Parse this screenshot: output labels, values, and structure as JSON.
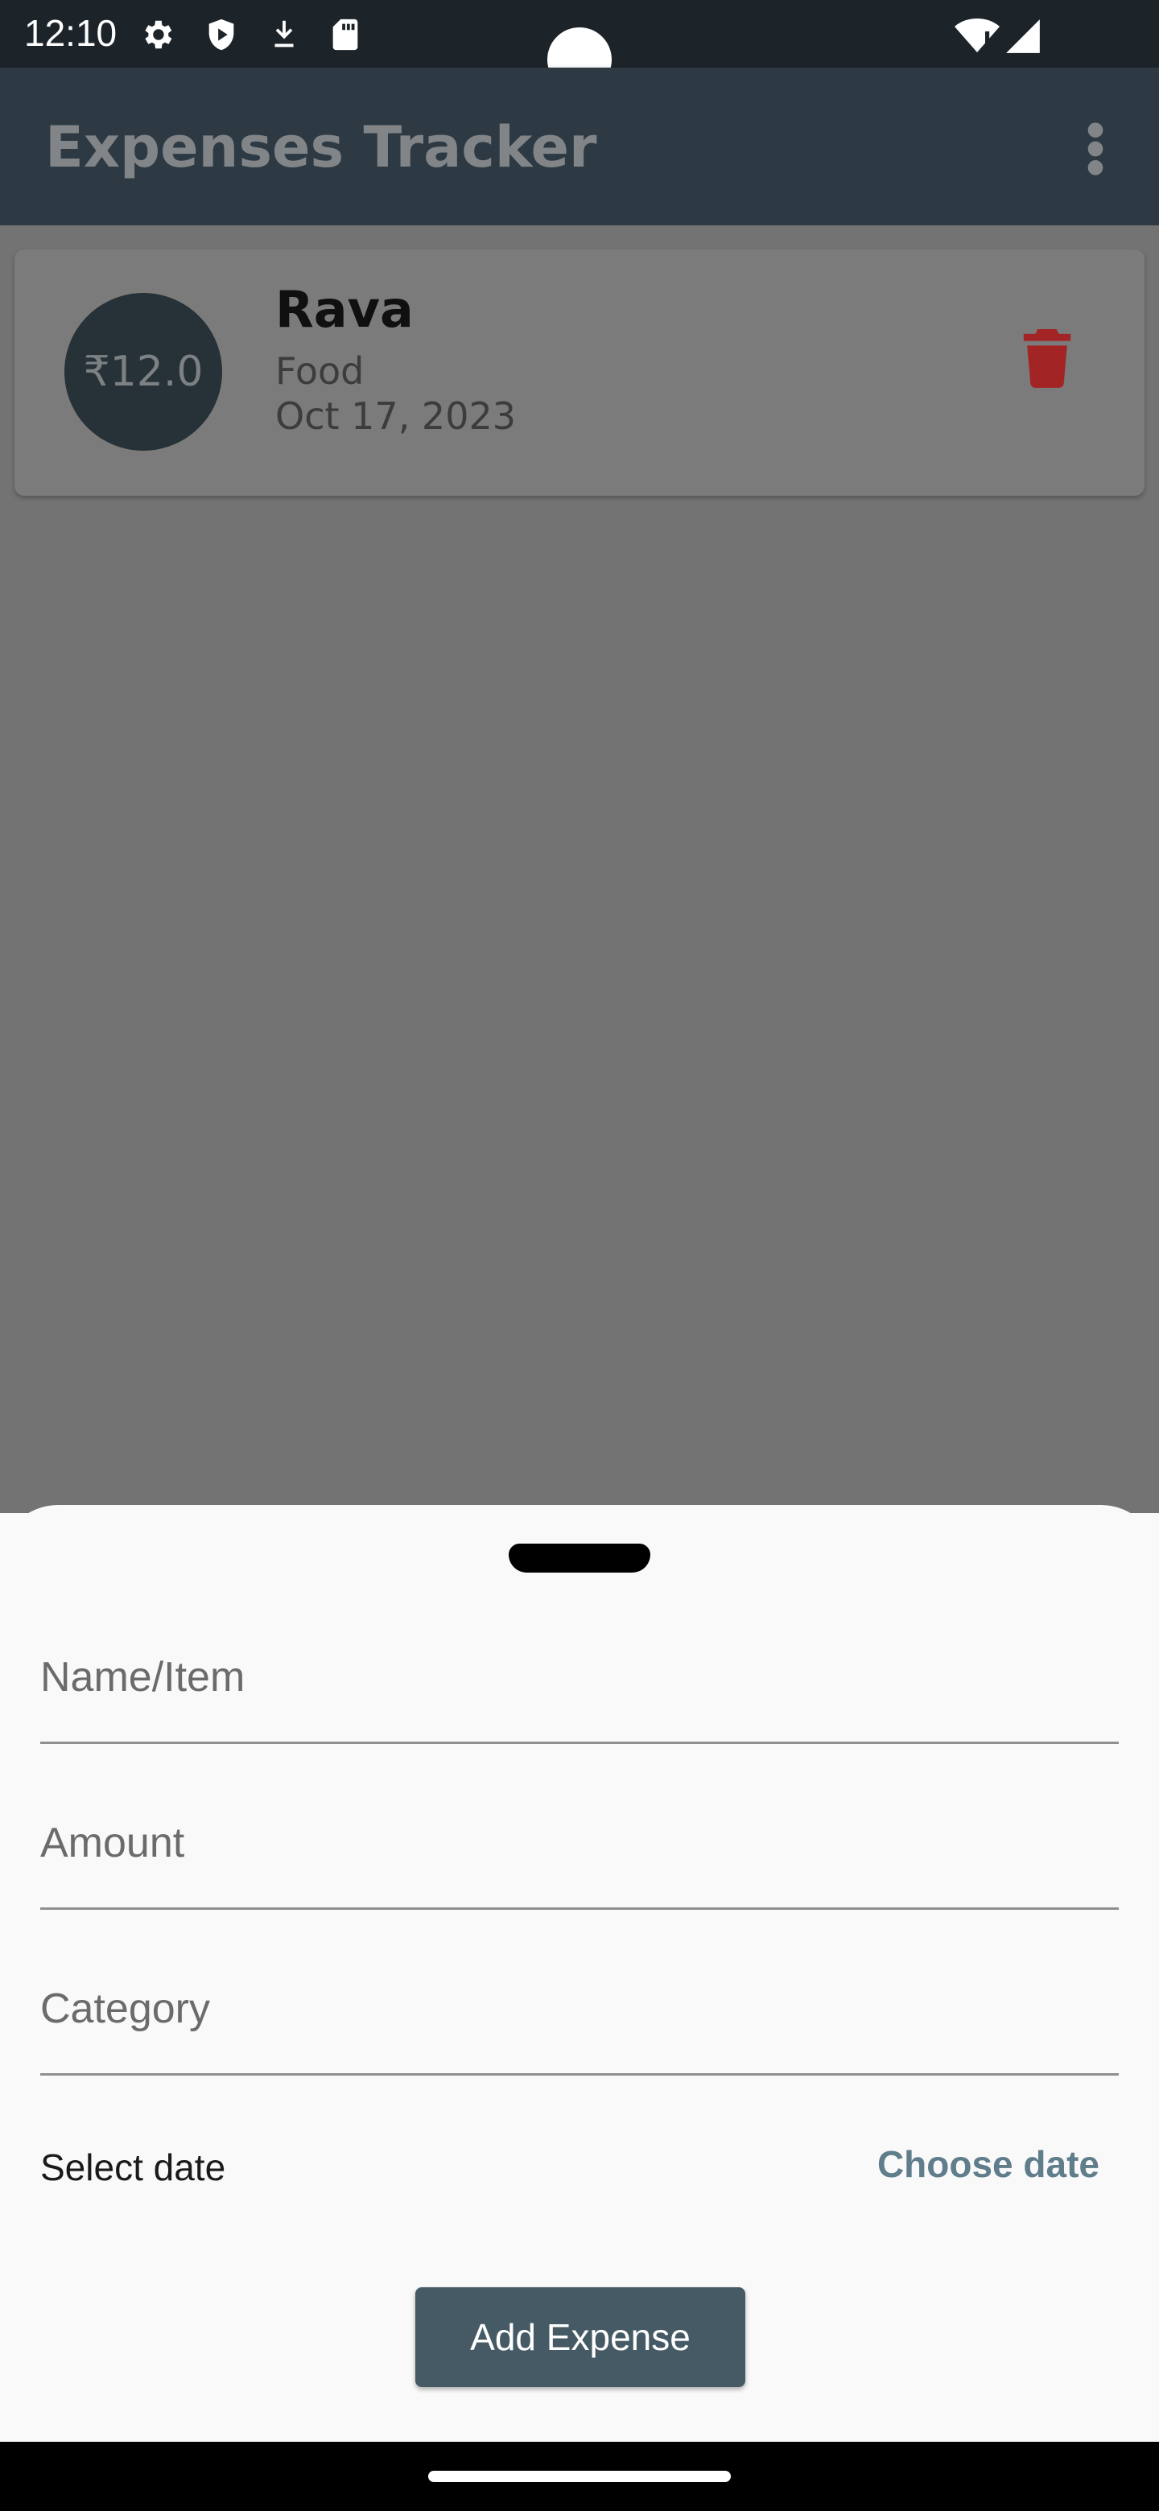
{
  "status_bar": {
    "time": "12:10",
    "icons": [
      "gear-icon",
      "shield-play-icon",
      "download-icon",
      "sd-card-icon",
      "wifi-icon",
      "signal-icon"
    ]
  },
  "app_bar": {
    "title": "Expenses Tracker",
    "menu_icon": "more-vertical-icon"
  },
  "expenses": [
    {
      "amount": "₹12.0",
      "name": "Rava",
      "category": "Food",
      "date": "Oct 17, 2023"
    }
  ],
  "sheet": {
    "name_placeholder": "Name/Item",
    "amount_placeholder": "Amount",
    "category_placeholder": "Category",
    "date_label": "Select date",
    "choose_date": "Choose date",
    "add_button": "Add Expense"
  },
  "colors": {
    "app_bar": "#2d3a43",
    "avatar": "#263238",
    "delete": "#a32424",
    "accent": "#607d8b",
    "button": "#455a64"
  }
}
